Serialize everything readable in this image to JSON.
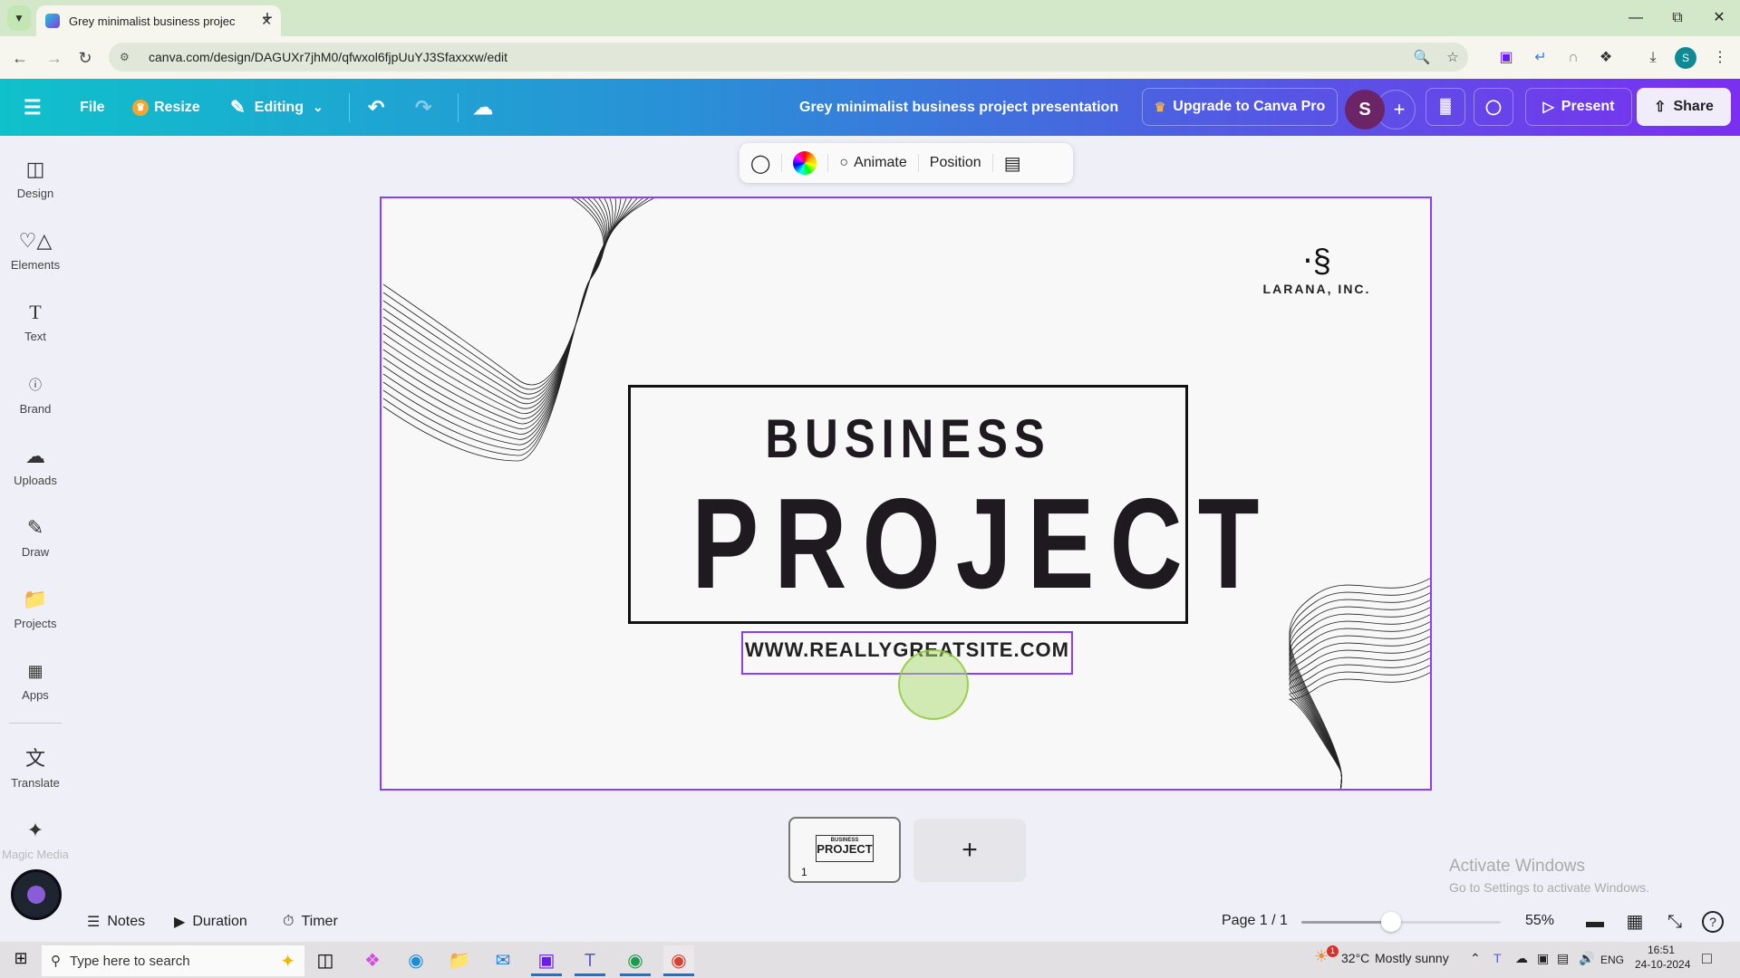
{
  "browser": {
    "tab_title": "Grey minimalist business projec",
    "url": "canva.com/design/DAGUXr7jhM0/qfwxol6fjpUuYJ3Sfaxxxw/edit",
    "profile_initial": "S"
  },
  "header": {
    "menu": "File",
    "resize": "Resize",
    "editing": "Editing",
    "doc_title": "Grey minimalist business project presentation",
    "upgrade": "Upgrade to Canva Pro",
    "avatar": "S",
    "present": "Present",
    "share": "Share"
  },
  "sidebar": {
    "items": [
      {
        "label": "Design",
        "icon": "design-icon"
      },
      {
        "label": "Elements",
        "icon": "elements-icon"
      },
      {
        "label": "Text",
        "icon": "text-icon"
      },
      {
        "label": "Brand",
        "icon": "brand-icon"
      },
      {
        "label": "Uploads",
        "icon": "uploads-icon"
      },
      {
        "label": "Draw",
        "icon": "draw-icon"
      },
      {
        "label": "Projects",
        "icon": "projects-icon"
      },
      {
        "label": "Apps",
        "icon": "apps-icon"
      },
      {
        "label": "Translate",
        "icon": "translate-icon"
      },
      {
        "label": "Magic Media",
        "icon": "magic-media-icon"
      }
    ]
  },
  "context_toolbar": {
    "animate": "Animate",
    "position": "Position"
  },
  "slide": {
    "logo_name": "LARANA, INC.",
    "heading_small": "BUSINESS",
    "heading_large": "PROJECT",
    "website": "WWW.REALLYGREATSITE.COM"
  },
  "pages": {
    "thumb_number": "1",
    "thumb_small": "BUSINESS",
    "thumb_large": "PROJECT"
  },
  "footer": {
    "notes": "Notes",
    "duration": "Duration",
    "timer": "Timer",
    "page_label": "Page 1 / 1",
    "zoom_percent": "55%",
    "zoom_slider_fraction": 0.45
  },
  "watermark": {
    "line1": "Activate Windows",
    "line2": "Go to Settings to activate Windows."
  },
  "taskbar": {
    "search_placeholder": "Type here to search",
    "weather_temp": "32°C",
    "weather_desc": "Mostly sunny",
    "weather_badge": "1",
    "lang": "ENG",
    "time": "16:51",
    "date": "24-10-2024"
  },
  "colors": {
    "selection": "#8b3dff",
    "header_start": "#0fc1cb",
    "header_end": "#7b2ff0",
    "text_dark": "#1e1a1f"
  }
}
